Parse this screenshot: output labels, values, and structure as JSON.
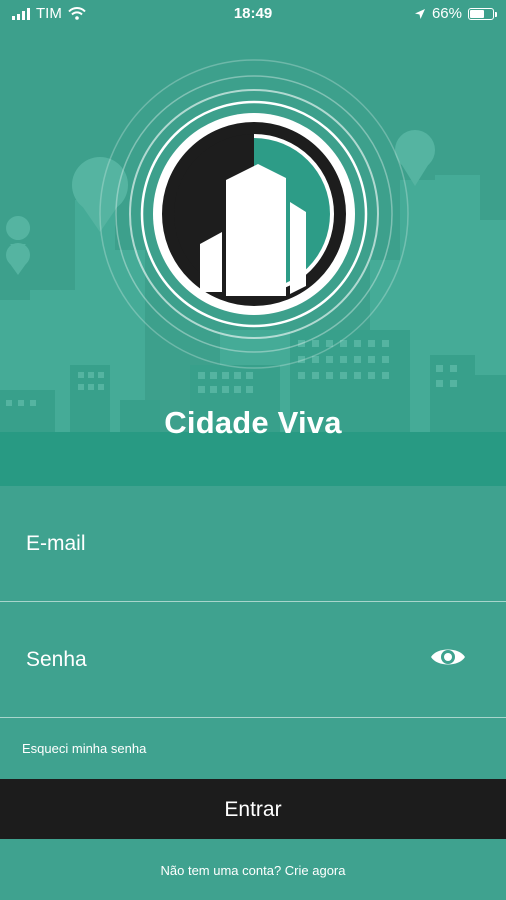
{
  "status_bar": {
    "carrier": "TIM",
    "time": "18:49",
    "battery": "66%",
    "battery_level": 0.66,
    "icons": [
      "signal-icon",
      "wifi-icon",
      "location-arrow-icon",
      "battery-icon"
    ]
  },
  "app": {
    "title": "Cidade Viva",
    "logo_icon": "city-buildings-logo"
  },
  "form": {
    "email_placeholder": "E-mail",
    "password_placeholder": "Senha",
    "password_toggle_icon": "eye-icon",
    "forgot_label": "Esqueci minha senha",
    "login_label": "Entrar",
    "signup_label": "Não tem uma conta? Crie agora"
  },
  "colors": {
    "primary": "#3fa28f",
    "hero_dark": "#289a83",
    "button": "#1c1c1c",
    "text": "#ffffff"
  }
}
